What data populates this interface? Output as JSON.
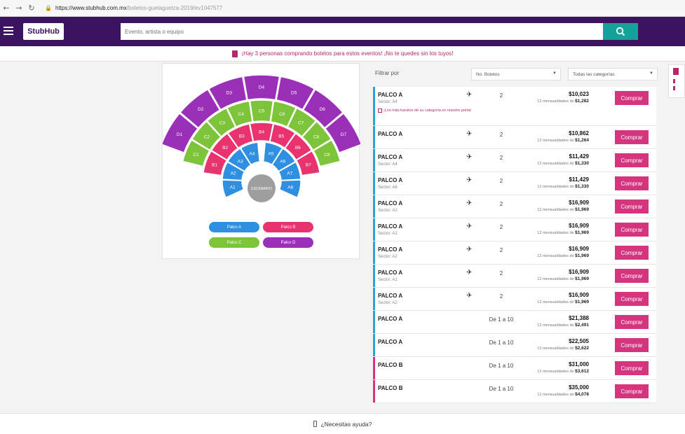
{
  "browser": {
    "url_domain": "https://www.stubhub.com.mx",
    "url_path": "/boletos-guelaguetza-2019/ev1047577"
  },
  "header": {
    "logo": "StubHub",
    "search_placeholder": "Evento, artista o equipo"
  },
  "banner": {
    "text": "¡Hay 3 personas comprando boletos para estos eventos! ¡No te quedes sin los tuyos!"
  },
  "map": {
    "stage_label": "ESCENARIO",
    "sections_d": [
      "D1",
      "D2",
      "D3",
      "D4",
      "D5",
      "D6",
      "D7"
    ],
    "sections_c": [
      "C1",
      "C2",
      "C3",
      "C4",
      "C5",
      "C6",
      "C7",
      "C8",
      "C9"
    ],
    "sections_b": [
      "B1",
      "B2",
      "B3",
      "B4",
      "B5",
      "B6",
      "B7"
    ],
    "sections_a_left": [
      "A1",
      "A2",
      "A3",
      "A4"
    ],
    "sections_a_right": [
      "A5",
      "A6",
      "A7",
      "A8"
    ],
    "legend": [
      {
        "label": "Palco A",
        "color": "#2f8fe0"
      },
      {
        "label": "Palco B",
        "color": "#e8336f"
      },
      {
        "label": "Palco C",
        "color": "#7ec43a"
      },
      {
        "label": "Palco D",
        "color": "#9b30b8"
      }
    ],
    "colors": {
      "a": "#2f8fe0",
      "b": "#e8336f",
      "c": "#7ec43a",
      "d": "#9b30b8",
      "stage": "#9e9e9e"
    }
  },
  "filters": {
    "label": "Filtrar por",
    "tickets": "No. Boletos",
    "categories": "Todas las categorías"
  },
  "listings": [
    {
      "name": "PALCO A",
      "sector": "Sector: A4",
      "note": "¡Los más baratos de su categoría en nuestro portal",
      "plane": true,
      "qty": "2",
      "price": "$10,023",
      "sub_prefix": "12 mensualidades de",
      "sub_value": "$1,282",
      "bar": "#2fa3d6",
      "buy": "Comprar"
    },
    {
      "name": "PALCO A",
      "sector": "",
      "note": "",
      "plane": true,
      "qty": "2",
      "price": "$10,862",
      "sub_prefix": "12 mensualidades de",
      "sub_value": "$1,264",
      "bar": "#2fa3d6",
      "buy": "Comprar"
    },
    {
      "name": "PALCO A",
      "sector": "Sector: A4",
      "note": "",
      "plane": true,
      "qty": "2",
      "price": "$11,429",
      "sub_prefix": "12 mensualidades de",
      "sub_value": "$1,330",
      "bar": "#2fa3d6",
      "buy": "Comprar"
    },
    {
      "name": "PALCO A",
      "sector": "Sector: A6",
      "note": "",
      "plane": true,
      "qty": "2",
      "price": "$11,429",
      "sub_prefix": "12 mensualidades de",
      "sub_value": "$1,330",
      "bar": "#2fa3d6",
      "buy": "Comprar"
    },
    {
      "name": "PALCO A",
      "sector": "Sector: A2",
      "note": "",
      "plane": true,
      "qty": "2",
      "price": "$16,909",
      "sub_prefix": "12 mensualidades de",
      "sub_value": "$1,969",
      "bar": "#2fa3d6",
      "buy": "Comprar"
    },
    {
      "name": "PALCO A",
      "sector": "Sector: A2",
      "note": "",
      "plane": true,
      "qty": "2",
      "price": "$16,909",
      "sub_prefix": "12 mensualidades de",
      "sub_value": "$1,969",
      "bar": "#2fa3d6",
      "buy": "Comprar"
    },
    {
      "name": "PALCO A",
      "sector": "Sector: A2",
      "note": "",
      "plane": true,
      "qty": "2",
      "price": "$16,909",
      "sub_prefix": "12 mensualidades de",
      "sub_value": "$1,969",
      "bar": "#2fa3d6",
      "buy": "Comprar"
    },
    {
      "name": "PALCO A",
      "sector": "Sector: A2",
      "note": "",
      "plane": true,
      "qty": "2",
      "price": "$16,909",
      "sub_prefix": "12 mensualidades de",
      "sub_value": "$1,969",
      "bar": "#2fa3d6",
      "buy": "Comprar"
    },
    {
      "name": "PALCO A",
      "sector": "Sector: A2",
      "note": "",
      "plane": true,
      "qty": "2",
      "price": "$16,909",
      "sub_prefix": "12 mensualidades de",
      "sub_value": "$1,969",
      "bar": "#2fa3d6",
      "buy": "Comprar"
    },
    {
      "name": "PALCO A",
      "sector": "",
      "note": "",
      "plane": false,
      "qty": "De 1 a 10",
      "price": "$21,388",
      "sub_prefix": "12 mensualidades de",
      "sub_value": "$2,491",
      "bar": "#2fa3d6",
      "buy": "Comprar"
    },
    {
      "name": "PALCO A",
      "sector": "",
      "note": "",
      "plane": false,
      "qty": "De 1 a 10",
      "price": "$22,505",
      "sub_prefix": "12 mensualidades de",
      "sub_value": "$2,622",
      "bar": "#2fa3d6",
      "buy": "Comprar"
    },
    {
      "name": "PALCO B",
      "sector": "",
      "note": "",
      "plane": false,
      "qty": "De 1 a 10",
      "price": "$31,000",
      "sub_prefix": "12 mensualidades de",
      "sub_value": "$3,612",
      "bar": "#d6357e",
      "buy": "Comprar"
    },
    {
      "name": "PALCO B",
      "sector": "",
      "note": "",
      "plane": false,
      "qty": "De 1 a 10",
      "price": "$35,000",
      "sub_prefix": "12 mensualidades de",
      "sub_value": "$4,078",
      "bar": "#d6357e",
      "buy": "Comprar"
    }
  ],
  "footer": {
    "help": "¿Necesitas ayuda?"
  }
}
